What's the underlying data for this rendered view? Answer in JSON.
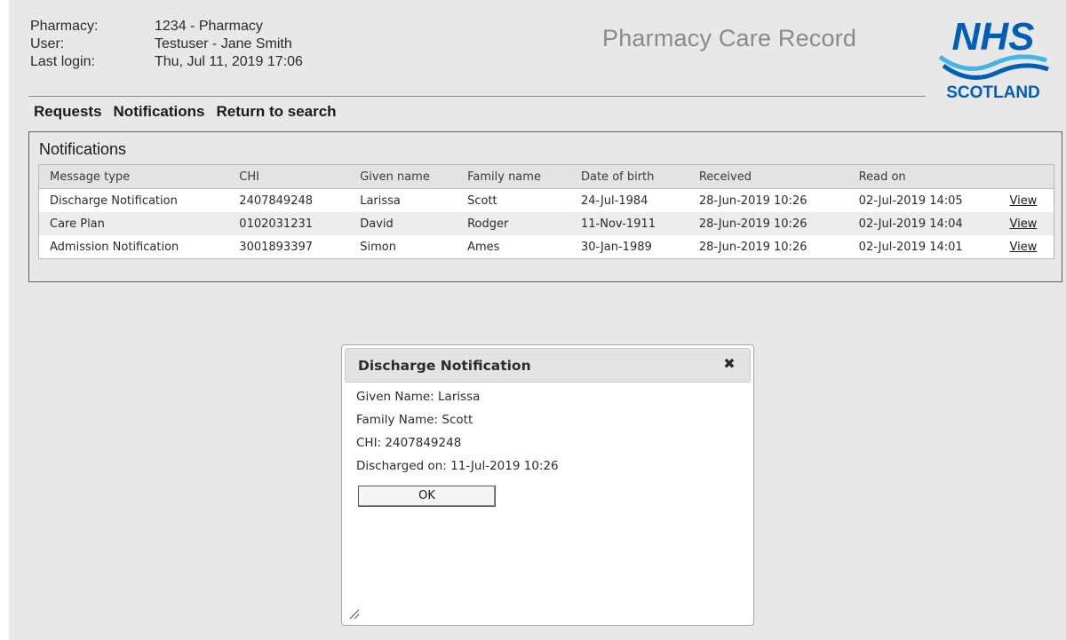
{
  "header": {
    "rows": [
      {
        "label": "Pharmacy:",
        "value": "1234 - Pharmacy"
      },
      {
        "label": "User:",
        "value": "Testuser - Jane Smith"
      },
      {
        "label": "Last login:",
        "value": "Thu, Jul 11, 2019 17:06"
      }
    ],
    "app_title": "Pharmacy Care Record",
    "logo": {
      "top": "NHS",
      "bottom": "SCOTLAND"
    }
  },
  "nav": [
    {
      "label": "Requests"
    },
    {
      "label": "Notifications"
    },
    {
      "label": "Return to search"
    }
  ],
  "panel": {
    "title": "Notifications",
    "columns": [
      "Message type",
      "CHI",
      "Given name",
      "Family name",
      "Date of birth",
      "Received",
      "Read on",
      ""
    ],
    "rows": [
      {
        "message_type": "Discharge Notification",
        "chi": "2407849248",
        "given_name": "Larissa",
        "family_name": "Scott",
        "dob": "24-Jul-1984",
        "received": "28-Jun-2019 10:26",
        "read_on": "02-Jul-2019 14:05",
        "action": "View"
      },
      {
        "message_type": "Care Plan",
        "chi": "0102031231",
        "given_name": "David",
        "family_name": "Rodger",
        "dob": "11-Nov-1911",
        "received": "28-Jun-2019 10:26",
        "read_on": "02-Jul-2019 14:04",
        "action": "View"
      },
      {
        "message_type": "Admission Notification",
        "chi": "3001893397",
        "given_name": "Simon",
        "family_name": "Ames",
        "dob": "30-Jan-1989",
        "received": "28-Jun-2019 10:26",
        "read_on": "02-Jul-2019 14:01",
        "action": "View"
      }
    ]
  },
  "dialog": {
    "title": "Discharge Notification",
    "close_icon": "close-icon",
    "lines": [
      "Given Name: Larissa",
      "Family Name: Scott",
      "CHI: 2407849248",
      "Discharged on: 11-Jul-2019 10:26"
    ],
    "ok_label": "OK"
  },
  "colors": {
    "nhs_blue": "#005EB8",
    "wave_light": "#41B6E6",
    "background": "#E8E8E8"
  }
}
